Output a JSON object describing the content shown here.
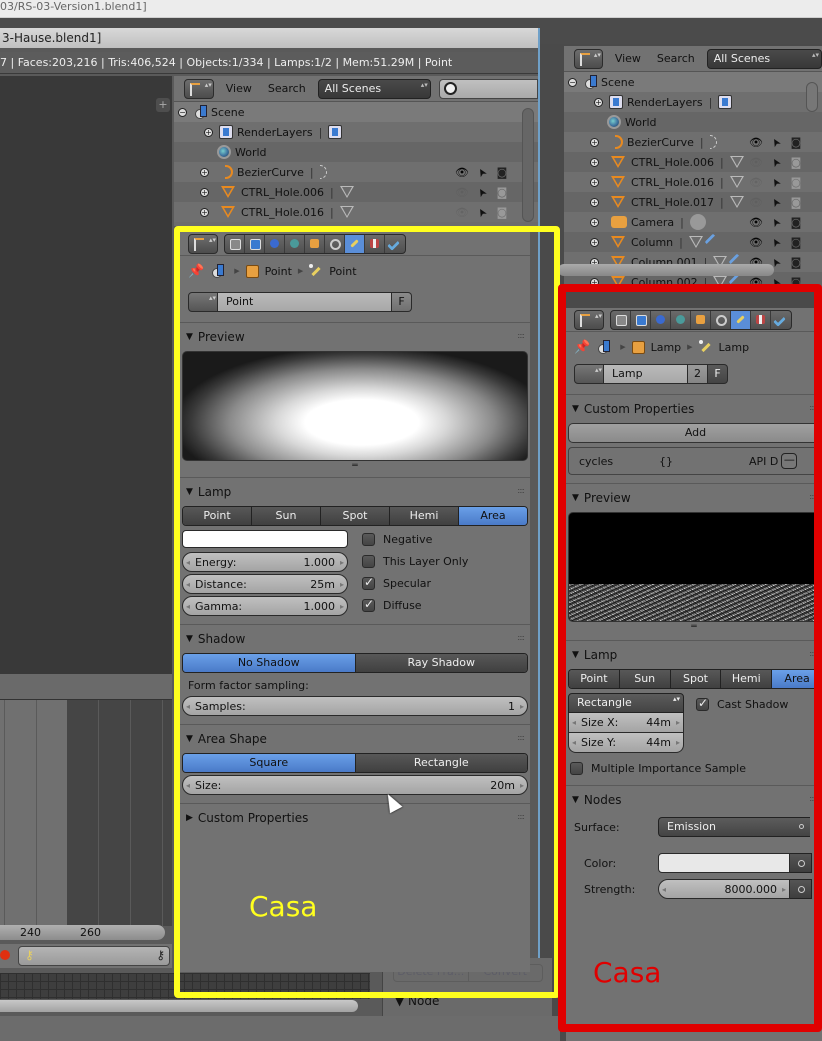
{
  "os_window": {
    "title": "03/RS-03-Version1.blend1]"
  },
  "front_window": {
    "title": "3-Hause.blend1]",
    "info_bar": "7 | Faces:203,216 | Tris:406,524 | Objects:1/334 | Lamps:1/2 | Mem:51.29M | Point",
    "timeline": {
      "ticks": [
        "240",
        "260"
      ]
    },
    "outliner": {
      "menu": [
        "View",
        "Search"
      ],
      "scene_filter": "All Scenes",
      "search_placeholder": "",
      "rows": [
        {
          "name": "Scene",
          "icon": "scene-icon"
        },
        {
          "name": "RenderLayers",
          "icon": "render-layers-icon"
        },
        {
          "name": "World",
          "icon": "world-icon"
        },
        {
          "name": "BezierCurve",
          "icon": "curve-icon",
          "visible": true
        },
        {
          "name": "CTRL_Hole.006",
          "icon": "mesh-icon",
          "visible": false
        },
        {
          "name": "CTRL_Hole.016",
          "icon": "mesh-icon",
          "visible": false
        }
      ]
    },
    "properties": {
      "breadcrumb": [
        "Point",
        "Point"
      ],
      "datablock": {
        "name": "Point",
        "fake_user": "F"
      },
      "preview_title": "Preview",
      "lamp": {
        "title": "Lamp",
        "types": [
          "Point",
          "Sun",
          "Spot",
          "Hemi",
          "Area"
        ],
        "active_type": "Area",
        "color": "#ffffff",
        "energy_label": "Energy:",
        "energy": "1.000",
        "distance_label": "Distance:",
        "distance": "25m",
        "gamma_label": "Gamma:",
        "gamma": "1.000",
        "checks": [
          {
            "label": "Negative",
            "checked": false
          },
          {
            "label": "This Layer Only",
            "checked": false
          },
          {
            "label": "Specular",
            "checked": true
          },
          {
            "label": "Diffuse",
            "checked": true
          }
        ]
      },
      "shadow": {
        "title": "Shadow",
        "options": [
          "No Shadow",
          "Ray Shadow"
        ],
        "active": "No Shadow",
        "sampling_label": "Form factor sampling:",
        "samples_label": "Samples:",
        "samples": "1"
      },
      "area_shape": {
        "title": "Area Shape",
        "options": [
          "Square",
          "Rectangle"
        ],
        "active": "Square",
        "size_label": "Size:",
        "size": "20m"
      },
      "custom_properties": {
        "title": "Custom Properties"
      }
    },
    "annotation": "Casa",
    "hidden_buttons": [
      "Delete Fra...",
      "Convert"
    ],
    "node_panel": "Node"
  },
  "back_window": {
    "outliner": {
      "menu": [
        "View",
        "Search"
      ],
      "scene_filter": "All Scenes",
      "rows": [
        {
          "name": "Scene",
          "icon": "scene-icon"
        },
        {
          "name": "RenderLayers",
          "icon": "render-layers-icon"
        },
        {
          "name": "World",
          "icon": "world-icon"
        },
        {
          "name": "BezierCurve",
          "icon": "curve-icon",
          "visible": true
        },
        {
          "name": "CTRL_Hole.006",
          "icon": "mesh-icon",
          "visible": false
        },
        {
          "name": "CTRL_Hole.016",
          "icon": "mesh-icon",
          "visible": false
        },
        {
          "name": "CTRL_Hole.017",
          "icon": "mesh-icon",
          "visible": false
        },
        {
          "name": "Camera",
          "icon": "camera-icon",
          "visible": true
        },
        {
          "name": "Column",
          "icon": "mesh-icon",
          "visible": true
        },
        {
          "name": "Column.001",
          "icon": "mesh-icon",
          "visible": true
        },
        {
          "name": "Column.002",
          "icon": "mesh-icon",
          "visible": true
        }
      ]
    },
    "properties": {
      "breadcrumb": [
        "Lamp",
        "Lamp"
      ],
      "datablock": {
        "name": "Lamp",
        "users": "2",
        "fake_user": "F"
      },
      "custom_properties": {
        "title": "Custom Properties",
        "add_label": "Add",
        "prop_name": "cycles",
        "prop_value": "{}",
        "prop_api": "API D"
      },
      "preview_title": "Preview",
      "lamp": {
        "title": "Lamp",
        "types": [
          "Point",
          "Sun",
          "Spot",
          "Hemi",
          "Area"
        ],
        "active_type": "Area",
        "shape": "Rectangle",
        "size_x_label": "Size X:",
        "size_x": "44m",
        "size_y_label": "Size Y:",
        "size_y": "44m",
        "cast_shadow_label": "Cast Shadow",
        "cast_shadow": true,
        "mis_label": "Multiple Importance Sample",
        "mis": false
      },
      "nodes": {
        "title": "Nodes",
        "surface_label": "Surface:",
        "surface": "Emission",
        "color_label": "Color:",
        "color": "#e8e8e8",
        "strength_label": "Strength:",
        "strength": "8000.000"
      }
    },
    "annotation": "Casa"
  },
  "colors": {
    "highlight_front": "#ffff1f",
    "highlight_back": "#e00000",
    "accent": "#5a8ed8"
  }
}
